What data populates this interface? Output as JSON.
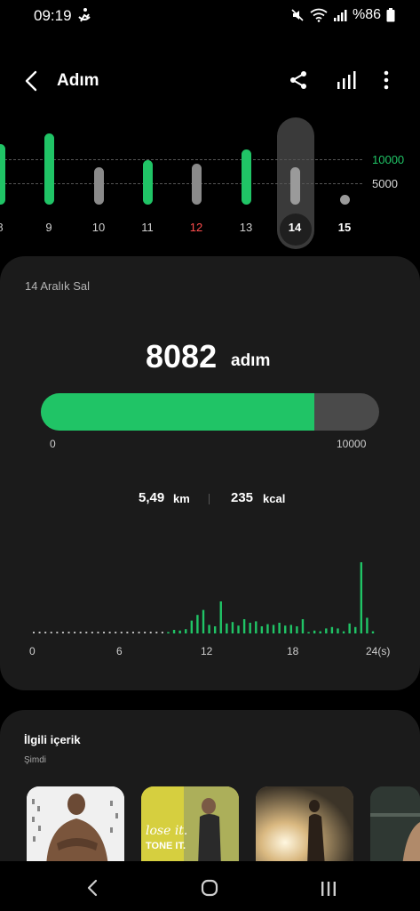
{
  "status_bar": {
    "time": "09:19",
    "battery": "%86"
  },
  "header": {
    "title": "Adım"
  },
  "day_chart": {
    "goal_label": "10000",
    "half_label": "5000",
    "days": [
      {
        "label": "8",
        "level": 0.85,
        "color": "#20c466"
      },
      {
        "label": "9",
        "level": 1.0,
        "color": "#20c466"
      },
      {
        "label": "10",
        "level": 0.52,
        "color": "#8a8a8a"
      },
      {
        "label": "11",
        "level": 0.62,
        "color": "#20c466"
      },
      {
        "label": "12",
        "level": 0.58,
        "color": "#8a8a8a",
        "label_color": "#ff4d4d"
      },
      {
        "label": "13",
        "level": 0.78,
        "color": "#20c466"
      },
      {
        "label": "14",
        "level": 0.52,
        "color": "#9a9a9a",
        "selected": true
      },
      {
        "label": "15",
        "level": 0.0,
        "color": "#9a9a9a",
        "label_color": "#ffffff"
      }
    ],
    "colors": {
      "accent": "#20c466",
      "inactive": "#8a8a8a"
    }
  },
  "summary": {
    "date": "14 Aralık Sal",
    "steps": "8082",
    "steps_unit": "adım",
    "goal": 10000,
    "progress": 0.8082,
    "min_label": "0",
    "max_label": "10000",
    "distance": "5,49",
    "distance_unit": "km",
    "calories": "235",
    "calories_unit": "kcal"
  },
  "hourly_chart": {
    "x_labels": [
      "0",
      "6",
      "12",
      "18",
      "24(s)"
    ],
    "values": [
      0,
      0,
      0,
      0,
      0,
      0,
      0,
      0,
      0,
      0,
      0,
      0,
      0,
      0,
      0,
      0,
      0,
      0,
      0,
      0,
      0,
      0,
      0,
      0.02,
      0.05,
      0.04,
      0.06,
      0.18,
      0.26,
      0.33,
      0.12,
      0.1,
      0.45,
      0.14,
      0.16,
      0.11,
      0.2,
      0.15,
      0.17,
      0.1,
      0.13,
      0.12,
      0.15,
      0.11,
      0.12,
      0.1,
      0.2,
      0.02,
      0.04,
      0.03,
      0.07,
      0.09,
      0.07,
      0.03,
      0.14,
      0.09,
      1.0,
      0.22,
      0.03
    ]
  },
  "related": {
    "title": "İlgili içerik",
    "subtitle": "Şimdi",
    "thumb_texts": [
      "lose it.",
      "TONE IT."
    ]
  }
}
